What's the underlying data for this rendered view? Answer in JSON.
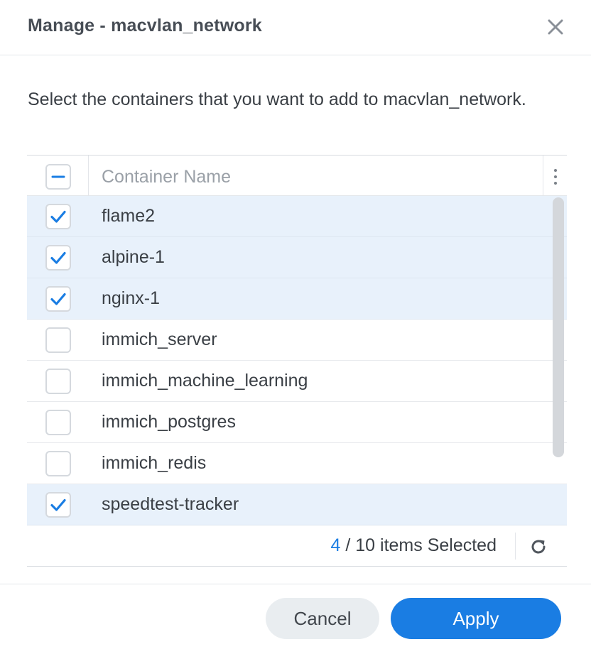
{
  "dialog": {
    "title": "Manage - macvlan_network",
    "description": "Select the containers that you want to add to macvlan_network."
  },
  "grid": {
    "column_header": "Container Name",
    "header_checkbox_state": "indeterminate",
    "rows": [
      {
        "name": "flame2",
        "checked": true
      },
      {
        "name": "alpine-1",
        "checked": true
      },
      {
        "name": "nginx-1",
        "checked": true
      },
      {
        "name": "immich_server",
        "checked": false
      },
      {
        "name": "immich_machine_learning",
        "checked": false
      },
      {
        "name": "immich_postgres",
        "checked": false
      },
      {
        "name": "immich_redis",
        "checked": false
      },
      {
        "name": "speedtest-tracker",
        "checked": true
      }
    ]
  },
  "footer": {
    "selected_count": "4",
    "selected_suffix": " / 10 items Selected"
  },
  "buttons": {
    "cancel": "Cancel",
    "apply": "Apply"
  },
  "colors": {
    "accent": "#1a7de3",
    "selected_row": "#e8f1fb"
  },
  "icons": {
    "close": "close-icon",
    "menu": "more-vertical-icon",
    "refresh": "refresh-icon",
    "check": "checkmark-icon",
    "indeterminate": "minus-icon"
  }
}
